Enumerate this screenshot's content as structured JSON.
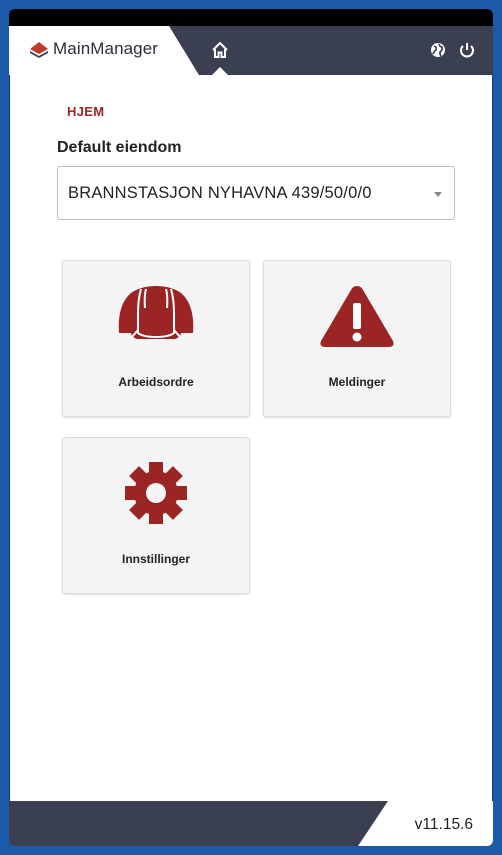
{
  "app": {
    "name": "MainManager",
    "version": "v11.15.6"
  },
  "header": {
    "home_icon": "home-icon",
    "globe_icon": "globe-icon",
    "power_icon": "power-icon"
  },
  "breadcrumb": "HJEM",
  "property": {
    "label": "Default eiendom",
    "selected": "BRANNSTASJON NYHAVNA 439/50/0/0"
  },
  "tiles": [
    {
      "label": "Arbeidsordre",
      "icon": "hard-hat-icon"
    },
    {
      "label": "Meldinger",
      "icon": "warning-icon"
    },
    {
      "label": "Innstillinger",
      "icon": "gear-icon"
    }
  ],
  "colors": {
    "accent": "#9b2424",
    "header": "#3a3f52",
    "frame": "#1a5aa8"
  }
}
